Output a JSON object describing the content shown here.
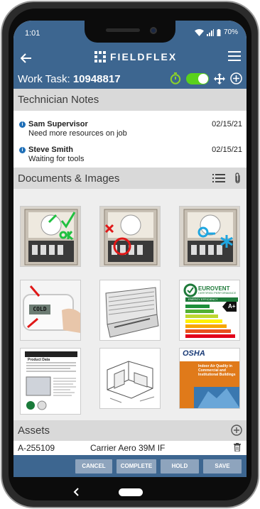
{
  "status_bar": {
    "time": "1:01",
    "battery": "70%"
  },
  "header": {
    "app_name": "FIELDFLEX",
    "task_label": "Work Task:",
    "task_number": "10948817"
  },
  "technician_notes": {
    "title": "Technician Notes",
    "items": [
      {
        "author": "Sam Supervisor",
        "text": "Need more resources on job",
        "date": "02/15/21"
      },
      {
        "author": "Steve Smith",
        "text": "Waiting for tools",
        "date": "02/15/21"
      }
    ]
  },
  "documents": {
    "title": "Documents & Images",
    "thumb_texts": {
      "cold": "COLD",
      "eurovent": "EUROVENT",
      "eurovent_sub": "CERTIFIED PERFORMANCE",
      "energy": "ENERGY EFFICIENCY",
      "rating": "A+",
      "osha": "OSHA",
      "osha_title": "Indoor Air Quality in Commercial and Institutional Buildings",
      "product_data": "Product Data"
    }
  },
  "assets": {
    "title": "Assets",
    "items": [
      {
        "id": "A-255109",
        "name": "Carrier Aero 39M IF"
      }
    ]
  },
  "actions": {
    "cancel": "CANCEL",
    "complete": "COMPLETE",
    "hold": "HOLD",
    "save": "SAVE"
  },
  "colors": {
    "primary": "#3d6690",
    "section": "#d9d9d9",
    "toggle_on": "#5ad11c",
    "timer": "#8bd12a"
  }
}
